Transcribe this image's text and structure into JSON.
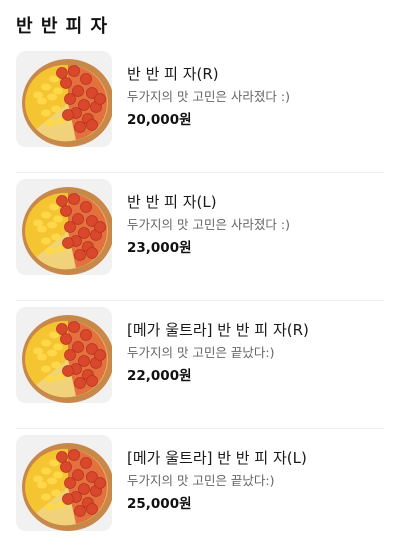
{
  "section": {
    "title": "반 반 피 자"
  },
  "items": [
    {
      "name": "반 반 피 자(R)",
      "description": "두가지의 맛 고민은 사라졌다 :)",
      "price": "20,000원"
    },
    {
      "name": "반 반 피 자(L)",
      "description": "두가지의 맛 고민은 사라졌다 :)",
      "price": "23,000원"
    },
    {
      "name": "[메가 울트라] 반 반 피 자(R)",
      "description": "두가지의 맛 고민은 끝났다:)",
      "price": "22,000원"
    },
    {
      "name": "[메가 울트라] 반 반 피 자(L)",
      "description": "두가지의 맛 고민은 끝났다:)",
      "price": "25,000원"
    }
  ],
  "colors": {
    "crust": "#c8884a",
    "pepperoni": "#d9482c",
    "cheese": "#f4c531",
    "thumb_bg": "#f1f1f1"
  }
}
